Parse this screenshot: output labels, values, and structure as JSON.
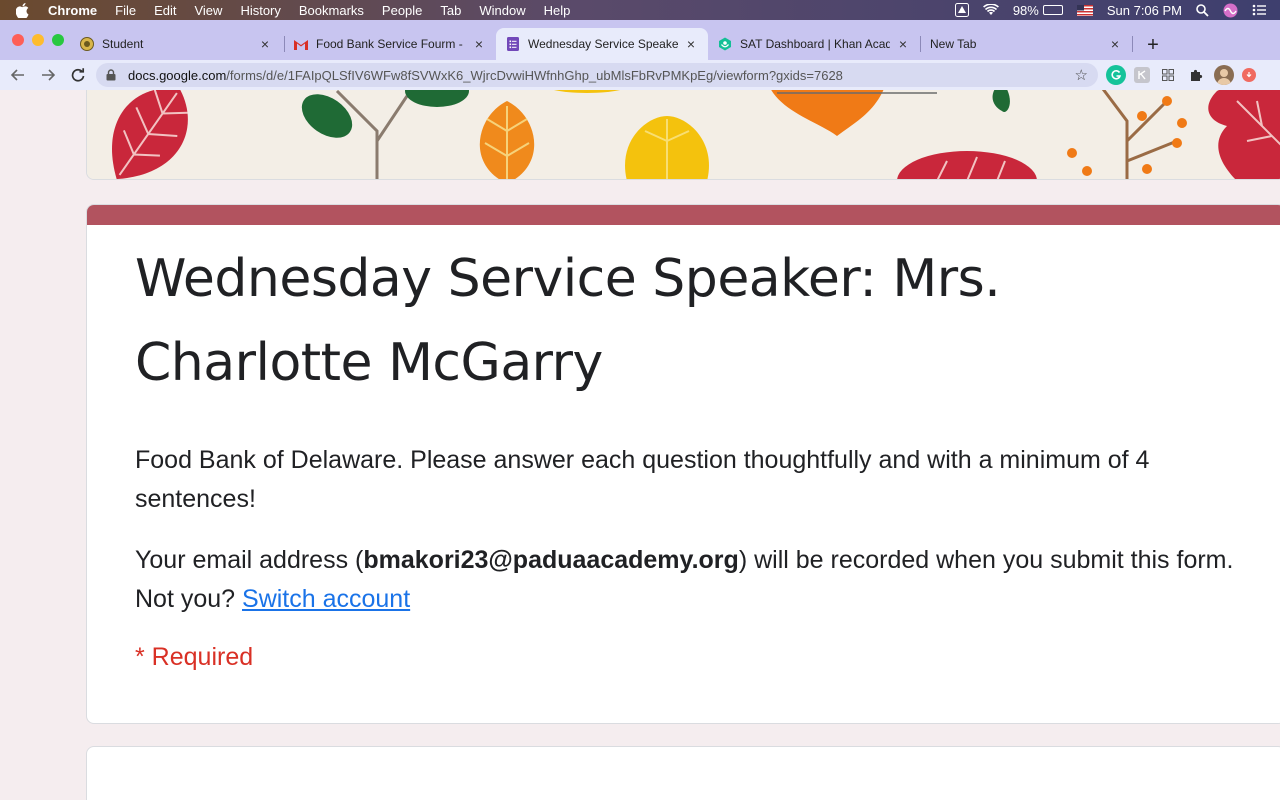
{
  "menubar": {
    "items": [
      "Chrome",
      "File",
      "Edit",
      "View",
      "History",
      "Bookmarks",
      "People",
      "Tab",
      "Window",
      "Help"
    ],
    "battery_percent": "98%",
    "battery_level": 0.98,
    "clock": "Sun 7:06 PM"
  },
  "tabs": [
    {
      "title": "Student",
      "icon": "student-globe-icon"
    },
    {
      "title": "Food Bank Service Fourm - bm",
      "icon": "gmail-icon"
    },
    {
      "title": "Wednesday Service Speaker: M",
      "icon": "google-forms-icon"
    },
    {
      "title": "SAT Dashboard | Khan Academ",
      "icon": "khan-academy-icon"
    },
    {
      "title": "New Tab",
      "icon": ""
    }
  ],
  "toolbar": {
    "url_host": "docs.google.com",
    "url_path": "/forms/d/e/1FAIpQLSfIV6WFw8fSVWxK6_WjrcDvwiHWfnhGhp_ubMlsFbRvPMKpEg/viewform?gxids=7628"
  },
  "form": {
    "title": "Wednesday Service Speaker: Mrs. Charlotte McGarry",
    "description": "Food Bank of Delaware.  Please answer each question thoughtfully and with a minimum of 4 sentences!",
    "email_prefix": "Your email address (",
    "email": "bmakori23@paduaacademy.org",
    "email_suffix": ") will be recorded when you submit this form. Not you? ",
    "switch_account": "Switch account",
    "required_note": "* Required"
  },
  "colors": {
    "theme_accent": "#b2535f",
    "link": "#1a73e8",
    "required": "#d93025",
    "page_bg": "#f5edef"
  }
}
